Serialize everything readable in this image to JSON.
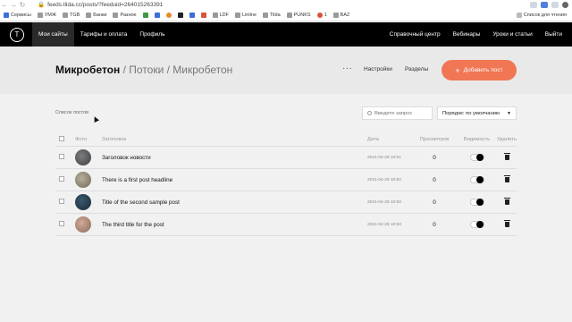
{
  "browser": {
    "url": "feeds.tilda.cc/posts/?feeduid=264015263391"
  },
  "bookmarks": {
    "items": [
      {
        "label": "Сервисы",
        "icon": "apps-grid-icon"
      },
      {
        "label": "УМЖ",
        "icon": "folder-icon"
      },
      {
        "label": "TGB",
        "icon": "folder-icon"
      },
      {
        "label": "Банки",
        "icon": "folder-icon"
      },
      {
        "label": "Разное",
        "icon": "folder-icon"
      },
      {
        "label": "LDF",
        "icon": "folder-icon"
      },
      {
        "label": "Linline",
        "icon": "folder-icon"
      },
      {
        "label": "Tilda",
        "icon": "folder-icon"
      },
      {
        "label": "PUNKS",
        "icon": "folder-icon"
      },
      {
        "label": "1",
        "icon": "bookmark-icon"
      },
      {
        "label": "BAZ",
        "icon": "folder-icon"
      }
    ],
    "reading_list": "Список для чтения"
  },
  "tilda_nav": {
    "logo": "T",
    "left": [
      "Мои сайты",
      "Тарифы и оплата",
      "Профиль"
    ],
    "right": [
      "Справочный центр",
      "Вебинары",
      "Уроки и статьи",
      "Выйти"
    ]
  },
  "page": {
    "breadcrumb_root": "Микробетон",
    "breadcrumb_rest": "/ Потоки / Микробетон",
    "menu_dots": "···",
    "settings": "Настройки",
    "sections": "Разделы",
    "add_post": "Добавить пост",
    "add_post_plus": "+"
  },
  "list": {
    "label": "Список постов",
    "search_placeholder": "Введите запрос",
    "sort": "Порядок: по умолчанию",
    "sort_chevron": "▼",
    "columns": {
      "photo": "Фото",
      "title": "Заголовок",
      "date": "Дата",
      "views": "Просмотров",
      "visibility": "Видимость",
      "delete": "Удалить"
    },
    "rows": [
      {
        "title": "Заголовок новости",
        "date": "2021-04-29 10:51",
        "views": "0"
      },
      {
        "title": "There is a first post headline",
        "date": "2021-04-29 10:50",
        "views": "0"
      },
      {
        "title": "Title of the second sample post",
        "date": "2021-04-29 10:50",
        "views": "0"
      },
      {
        "title": "The third title for the post",
        "date": "2021-04-29 10:50",
        "views": "0"
      }
    ]
  }
}
